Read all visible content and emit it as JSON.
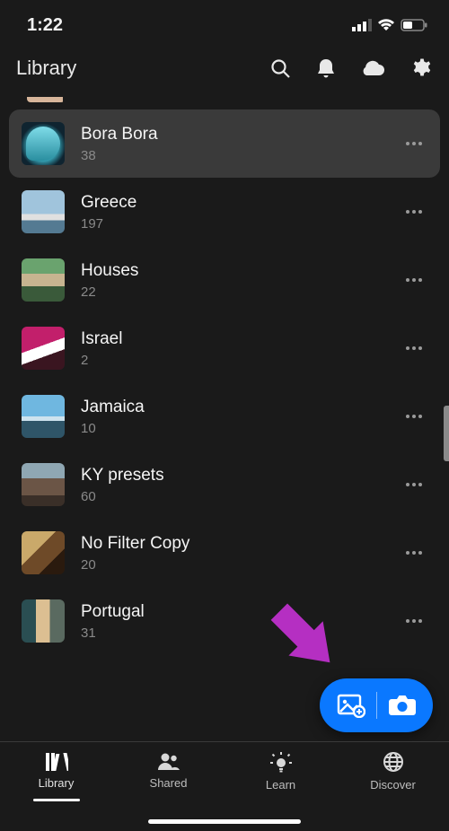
{
  "status": {
    "time": "1:22"
  },
  "header": {
    "title": "Library"
  },
  "albums": [
    {
      "title": "Bora Bora",
      "count": "38",
      "selected": true,
      "thumb": "th-bora"
    },
    {
      "title": "Greece",
      "count": "197",
      "selected": false,
      "thumb": "th-greece"
    },
    {
      "title": "Houses",
      "count": "22",
      "selected": false,
      "thumb": "th-houses"
    },
    {
      "title": "Israel",
      "count": "2",
      "selected": false,
      "thumb": "th-israel"
    },
    {
      "title": "Jamaica",
      "count": "10",
      "selected": false,
      "thumb": "th-jamaica"
    },
    {
      "title": "KY presets",
      "count": "60",
      "selected": false,
      "thumb": "th-ky"
    },
    {
      "title": "No Filter Copy",
      "count": "20",
      "selected": false,
      "thumb": "th-nofilter"
    },
    {
      "title": "Portugal",
      "count": "31",
      "selected": false,
      "thumb": "th-portugal"
    }
  ],
  "nav": {
    "items": [
      {
        "label": "Library",
        "active": true
      },
      {
        "label": "Shared",
        "active": false
      },
      {
        "label": "Learn",
        "active": false
      },
      {
        "label": "Discover",
        "active": false
      }
    ]
  },
  "colors": {
    "accent": "#0a78ff",
    "arrow": "#b52fc2"
  }
}
